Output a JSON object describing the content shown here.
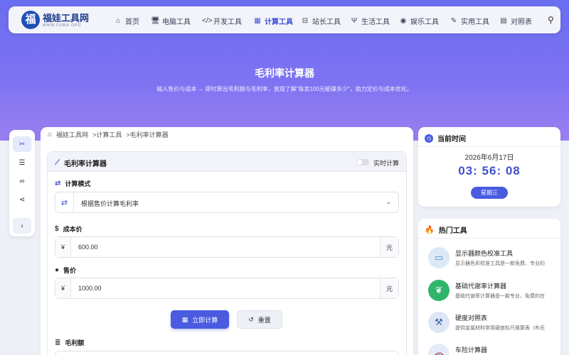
{
  "nav": {
    "brand": "福娃工具网",
    "brand_sub": "WWW.FUWA.ORG",
    "logo_char": "福",
    "items": [
      {
        "label": "首页",
        "icon": "home-icon",
        "glyph": "⌂",
        "active": false
      },
      {
        "label": "电脑工具",
        "icon": "computer-icon",
        "glyph": "🖥",
        "active": false
      },
      {
        "label": "开发工具",
        "icon": "code-icon",
        "glyph": "</>",
        "active": false
      },
      {
        "label": "计算工具",
        "icon": "calculator-icon",
        "glyph": "▦",
        "active": true
      },
      {
        "label": "站长工具",
        "icon": "toolbox-icon",
        "glyph": "⊟",
        "active": false
      },
      {
        "label": "生活工具",
        "icon": "utensils-icon",
        "glyph": "Ψ",
        "active": false
      },
      {
        "label": "娱乐工具",
        "icon": "gamepad-icon",
        "glyph": "◉",
        "active": false
      },
      {
        "label": "实用工具",
        "icon": "wrench-icon",
        "glyph": "✎",
        "active": false
      },
      {
        "label": "对照表",
        "icon": "table-icon",
        "glyph": "▤",
        "active": false
      }
    ]
  },
  "hero": {
    "title": "毛利率计算器",
    "subtitle": "输入售价与成本 → 即时算出毛利额与毛利率，直观了解\"每卖100元能赚多少\"，助力定价与成本优化。"
  },
  "breadcrumb": [
    "福娃工具网",
    ">计算工具",
    ">毛利率计算器"
  ],
  "calculator": {
    "title": "毛利率计算器",
    "realtime_label": "实时计算",
    "mode_label": "计算模式",
    "mode_value": "根据售价计算毛利率",
    "cost_label": "成本价",
    "cost_prefix": "¥",
    "cost_value": "600.00",
    "cost_suffix": "元",
    "price_label": "售价",
    "price_prefix": "¥",
    "price_value": "1000.00",
    "price_suffix": "元",
    "calc_button": "立即计算",
    "reset_button": "重置",
    "result_label": "毛利额"
  },
  "time_panel": {
    "title": "当前时间",
    "date": "2026年6月17日",
    "time": "03: 56: 08",
    "weekday": "星期三"
  },
  "hot_panel": {
    "title": "热门工具",
    "items": [
      {
        "name": "显示器颜色校准工具",
        "desc": "显示器色彩校准工具是一款免费、专业的",
        "icon": "monitor-icon",
        "bg": "#dbe9f7",
        "fg": "#4a8ad4",
        "glyph": "▭"
      },
      {
        "name": "基础代谢率计算器",
        "desc": "基础代谢率计算器是一款专业、免费的在",
        "icon": "leaf-icon",
        "bg": "#2fb56a",
        "fg": "#ffffff",
        "glyph": "❦"
      },
      {
        "name": "硬度对照表",
        "desc": "提供金属材料常用硬度标尺换算表（布氏",
        "icon": "hammer-icon",
        "bg": "#dde6f5",
        "fg": "#3f5fa8",
        "glyph": "⚒"
      },
      {
        "name": "车险计算器",
        "desc": "",
        "icon": "car-icon",
        "bg": "#e3ecf8",
        "fg": "#2f6fc8",
        "glyph": "🚗"
      }
    ]
  },
  "colors": {
    "accent": "#4a5be0",
    "hero_top": "#6a6ef0",
    "hero_bottom": "#9a7ff0"
  }
}
